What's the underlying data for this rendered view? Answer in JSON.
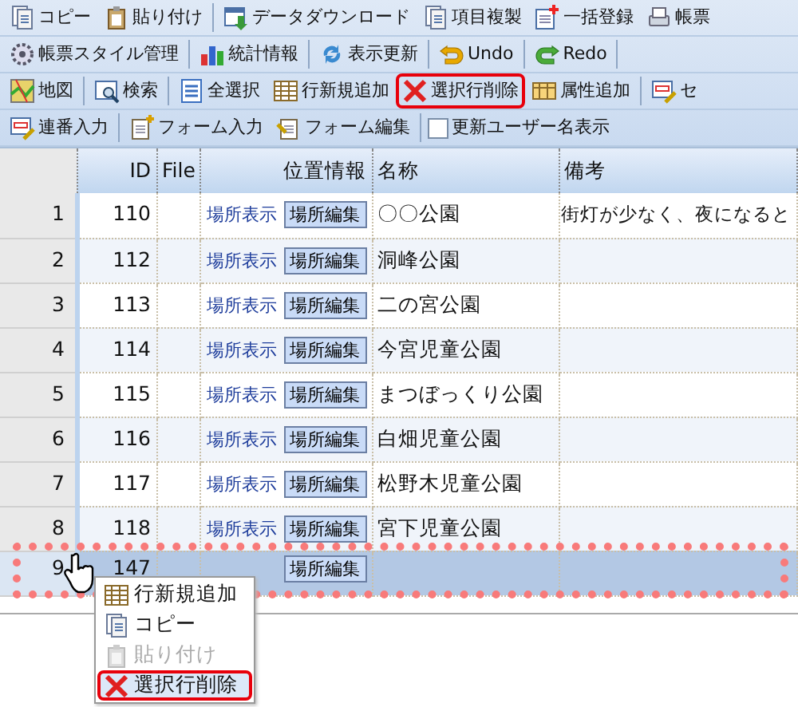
{
  "toolbar": {
    "rows": [
      {
        "items": [
          {
            "kind": "button",
            "label": "コピー"
          },
          {
            "kind": "button",
            "label": "貼り付け"
          },
          {
            "kind": "separator"
          },
          {
            "kind": "button",
            "label": "データダウンロード"
          },
          {
            "kind": "button",
            "label": "項目複製"
          },
          {
            "kind": "button",
            "label": "一括登録"
          },
          {
            "kind": "button",
            "label": "帳票"
          }
        ]
      },
      {
        "items": [
          {
            "kind": "button",
            "label": "帳票スタイル管理"
          },
          {
            "kind": "separator"
          },
          {
            "kind": "button",
            "label": "統計情報"
          },
          {
            "kind": "separator"
          },
          {
            "kind": "button",
            "label": "表示更新"
          },
          {
            "kind": "separator"
          },
          {
            "kind": "button",
            "label": "Undo"
          },
          {
            "kind": "separator"
          },
          {
            "kind": "button",
            "label": "Redo"
          },
          {
            "kind": "separator"
          }
        ]
      },
      {
        "items": [
          {
            "kind": "button",
            "label": "地図"
          },
          {
            "kind": "separator"
          },
          {
            "kind": "button",
            "label": "検索"
          },
          {
            "kind": "separator"
          },
          {
            "kind": "button",
            "label": "全選択"
          },
          {
            "kind": "button",
            "label": "行新規追加"
          },
          {
            "kind": "button",
            "label": "選択行削除",
            "highlighted": true
          },
          {
            "kind": "button",
            "label": "属性追加"
          },
          {
            "kind": "separator"
          },
          {
            "kind": "button",
            "label": "セ"
          }
        ]
      },
      {
        "items": [
          {
            "kind": "button",
            "label": "連番入力"
          },
          {
            "kind": "separator"
          },
          {
            "kind": "button",
            "label": "フォーム入力"
          },
          {
            "kind": "button",
            "label": "フォーム編集"
          },
          {
            "kind": "separator"
          },
          {
            "kind": "checkbox",
            "label": "更新ユーザー名表示",
            "checked": false
          }
        ]
      }
    ]
  },
  "grid": {
    "columns": [
      "ID",
      "File",
      "位置情報",
      "名称",
      "備考"
    ],
    "rows": [
      {
        "number": "1",
        "id": "110",
        "location_link": "場所表示",
        "location_button": "場所編集",
        "name": "〇〇公園",
        "note": "街灯が少なく、夜になると",
        "selected": false
      },
      {
        "number": "2",
        "id": "112",
        "location_link": "場所表示",
        "location_button": "場所編集",
        "name": "洞峰公園",
        "selected": false
      },
      {
        "number": "3",
        "id": "113",
        "location_link": "場所表示",
        "location_button": "場所編集",
        "name": "二の宮公園",
        "selected": false
      },
      {
        "number": "4",
        "id": "114",
        "location_link": "場所表示",
        "location_button": "場所編集",
        "name": "今宮児童公園",
        "selected": false
      },
      {
        "number": "5",
        "id": "115",
        "location_link": "場所表示",
        "location_button": "場所編集",
        "name": "まつぼっくり公園",
        "selected": false
      },
      {
        "number": "6",
        "id": "116",
        "location_link": "場所表示",
        "location_button": "場所編集",
        "name": "白畑児童公園",
        "selected": false
      },
      {
        "number": "7",
        "id": "117",
        "location_link": "場所表示",
        "location_button": "場所編集",
        "name": "松野木児童公園",
        "selected": false
      },
      {
        "number": "8",
        "id": "118",
        "location_link": "場所表示",
        "location_button": "場所編集",
        "name": "宮下児童公園",
        "selected": false
      },
      {
        "number": "9",
        "id": "147",
        "location_button": "場所編集",
        "selected": true
      }
    ]
  },
  "context_menu": {
    "items": [
      {
        "label": "行新規追加",
        "disabled": false,
        "highlighted": false
      },
      {
        "label": "コピー",
        "disabled": false,
        "highlighted": false
      },
      {
        "label": "貼り付け",
        "disabled": true,
        "highlighted": false
      },
      {
        "label": "選択行削除",
        "disabled": false,
        "highlighted": true
      }
    ]
  }
}
